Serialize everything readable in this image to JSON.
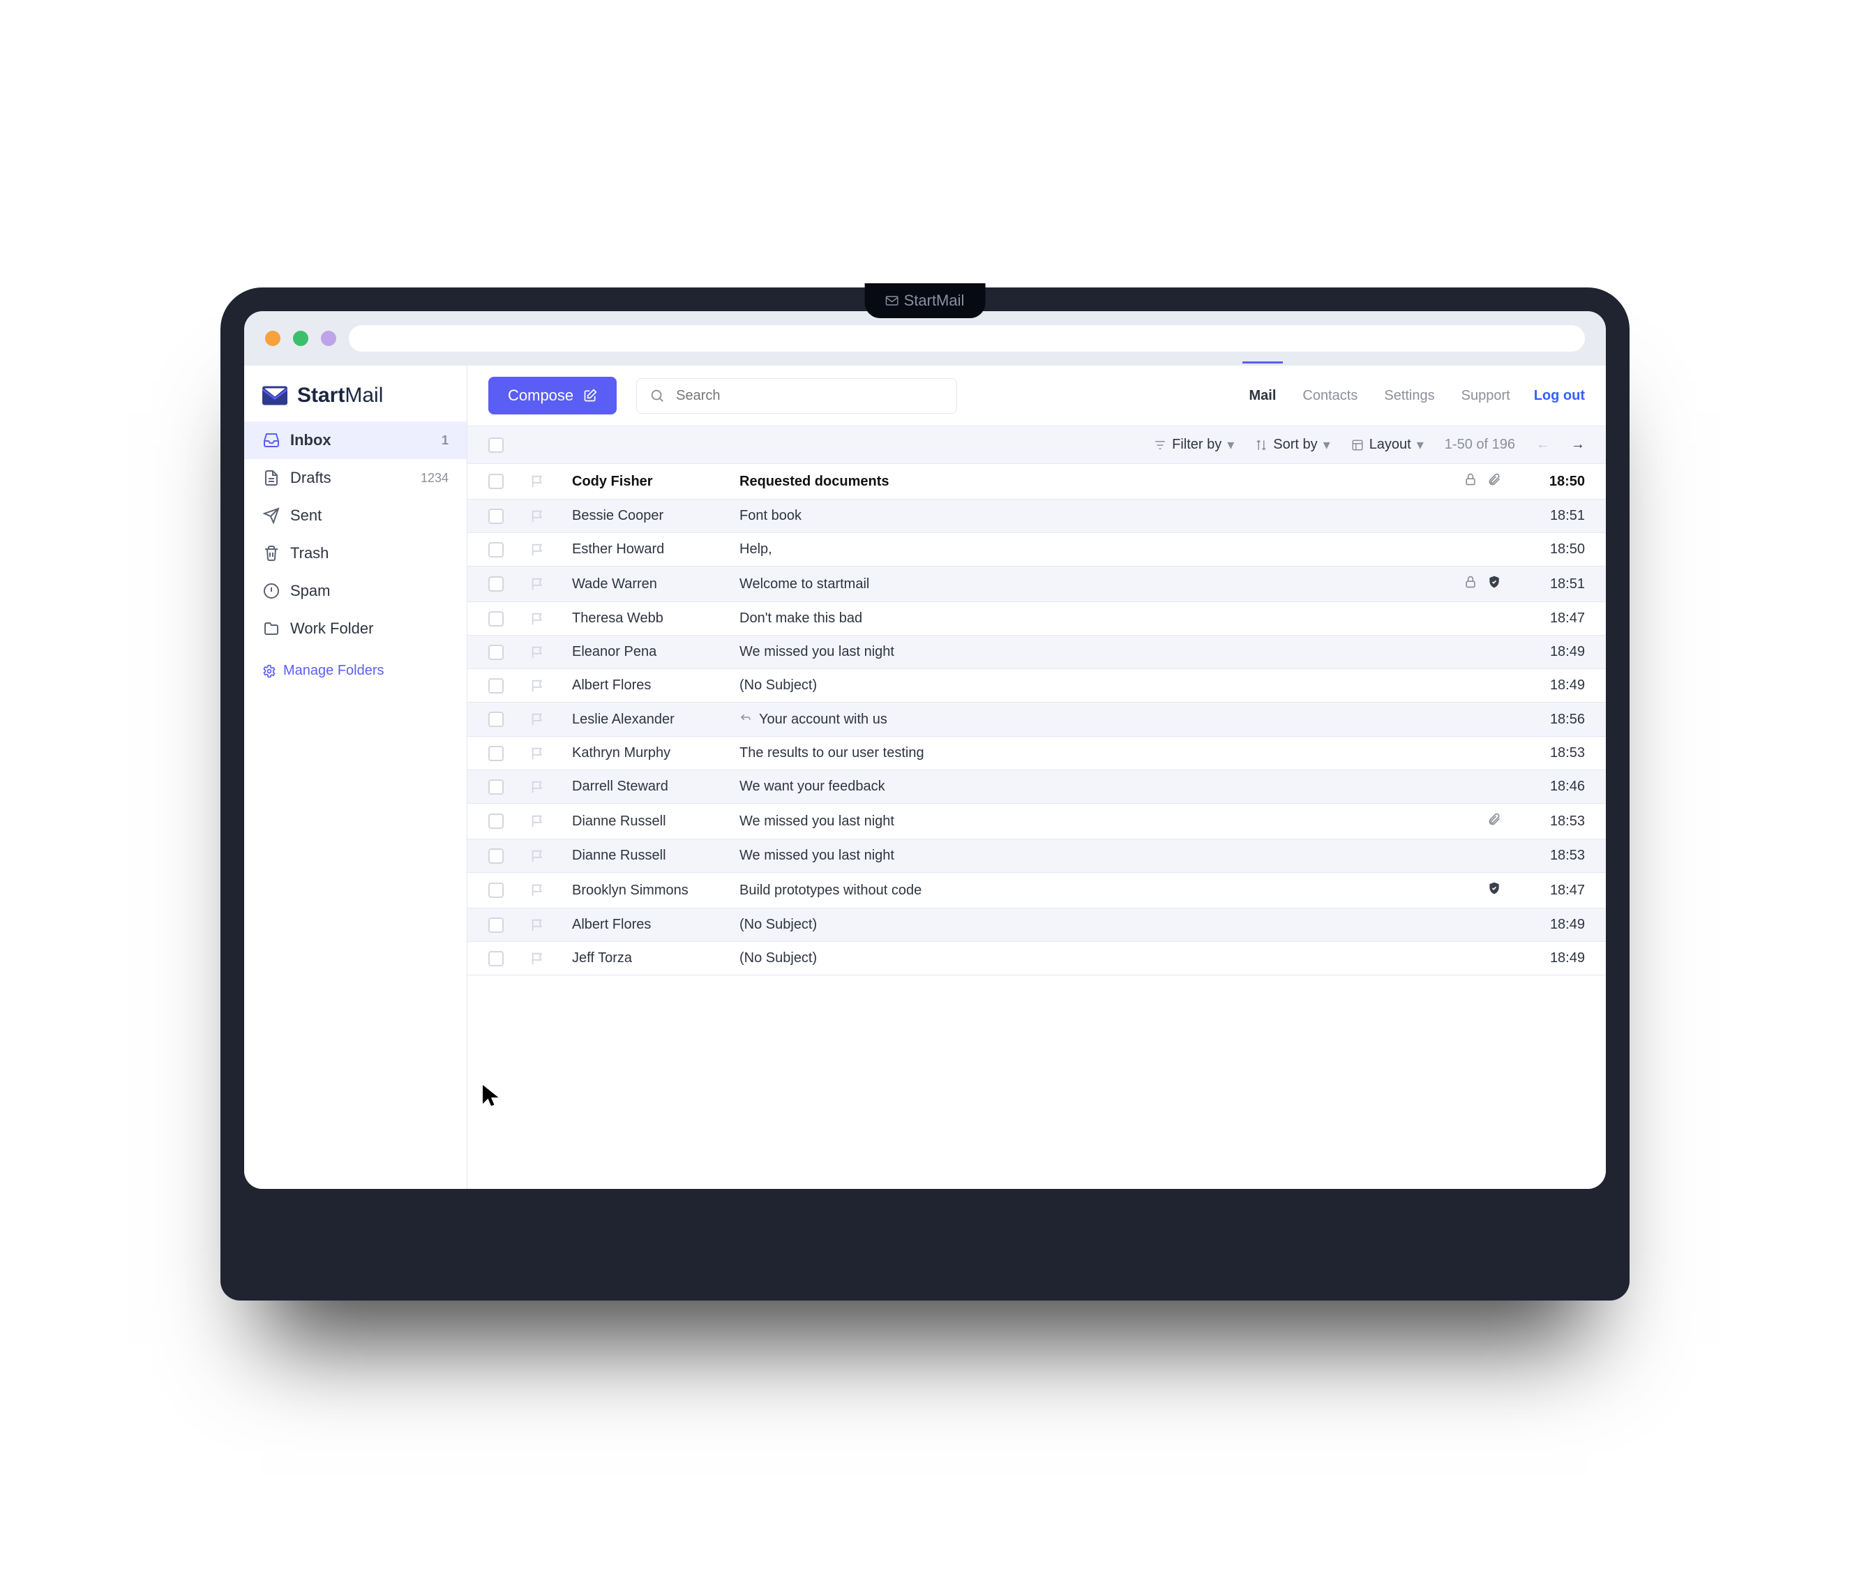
{
  "device_tab": "StartMail",
  "brand": {
    "prefix": "Start",
    "suffix": "Mail"
  },
  "sidebar": {
    "folders": [
      {
        "icon": "inbox",
        "label": "Inbox",
        "count": "1"
      },
      {
        "icon": "draft",
        "label": "Drafts",
        "count": "1234"
      },
      {
        "icon": "sent",
        "label": "Sent",
        "count": ""
      },
      {
        "icon": "trash",
        "label": "Trash",
        "count": ""
      },
      {
        "icon": "spam",
        "label": "Spam",
        "count": ""
      },
      {
        "icon": "folder",
        "label": "Work Folder",
        "count": ""
      }
    ],
    "manage_label": "Manage Folders"
  },
  "topbar": {
    "compose_label": "Compose",
    "search_placeholder": "Search",
    "tabs": [
      "Mail",
      "Contacts",
      "Settings",
      "Support"
    ],
    "active_tab": 0,
    "logout_label": "Log out"
  },
  "toolbar": {
    "filter_label": "Filter by",
    "sort_label": "Sort by",
    "layout_label": "Layout",
    "range_label": "1-50 of 196"
  },
  "messages": [
    {
      "sender": "Cody Fisher",
      "subject": "Requested documents",
      "time": "18:50",
      "unread": true,
      "lock": true,
      "attach": true,
      "shield": false,
      "forward": false
    },
    {
      "sender": "Bessie Cooper",
      "subject": "Font book",
      "time": "18:51",
      "unread": false,
      "lock": false,
      "attach": false,
      "shield": false,
      "forward": false
    },
    {
      "sender": "Esther Howard",
      "subject": "Help,",
      "time": "18:50",
      "unread": false,
      "lock": false,
      "attach": false,
      "shield": false,
      "forward": false
    },
    {
      "sender": "Wade Warren",
      "subject": "Welcome to startmail",
      "time": "18:51",
      "unread": false,
      "lock": true,
      "attach": false,
      "shield": true,
      "forward": false
    },
    {
      "sender": "Theresa Webb",
      "subject": "Don't make this bad",
      "time": "18:47",
      "unread": false,
      "lock": false,
      "attach": false,
      "shield": false,
      "forward": false
    },
    {
      "sender": "Eleanor Pena",
      "subject": "We missed you last night",
      "time": "18:49",
      "unread": false,
      "lock": false,
      "attach": false,
      "shield": false,
      "forward": false
    },
    {
      "sender": "Albert Flores",
      "subject": "(No Subject)",
      "time": "18:49",
      "unread": false,
      "lock": false,
      "attach": false,
      "shield": false,
      "forward": false
    },
    {
      "sender": "Leslie Alexander",
      "subject": "Your account with us",
      "time": "18:56",
      "unread": false,
      "lock": false,
      "attach": false,
      "shield": false,
      "forward": true
    },
    {
      "sender": "Kathryn Murphy",
      "subject": "The results to our user testing",
      "time": "18:53",
      "unread": false,
      "lock": false,
      "attach": false,
      "shield": false,
      "forward": false
    },
    {
      "sender": "Darrell Steward",
      "subject": "We want your feedback",
      "time": "18:46",
      "unread": false,
      "lock": false,
      "attach": false,
      "shield": false,
      "forward": false
    },
    {
      "sender": "Dianne Russell",
      "subject": "We missed you last night",
      "time": "18:53",
      "unread": false,
      "lock": false,
      "attach": true,
      "shield": false,
      "forward": false
    },
    {
      "sender": "Dianne Russell",
      "subject": "We missed you last night",
      "time": "18:53",
      "unread": false,
      "lock": false,
      "attach": false,
      "shield": false,
      "forward": false
    },
    {
      "sender": "Brooklyn Simmons",
      "subject": "Build prototypes without code",
      "time": "18:47",
      "unread": false,
      "lock": false,
      "attach": false,
      "shield": true,
      "forward": false
    },
    {
      "sender": "Albert Flores",
      "subject": "(No Subject)",
      "time": "18:49",
      "unread": false,
      "lock": false,
      "attach": false,
      "shield": false,
      "forward": false
    },
    {
      "sender": "Jeff Torza",
      "subject": "(No Subject)",
      "time": "18:49",
      "unread": false,
      "lock": false,
      "attach": false,
      "shield": false,
      "forward": false
    }
  ]
}
